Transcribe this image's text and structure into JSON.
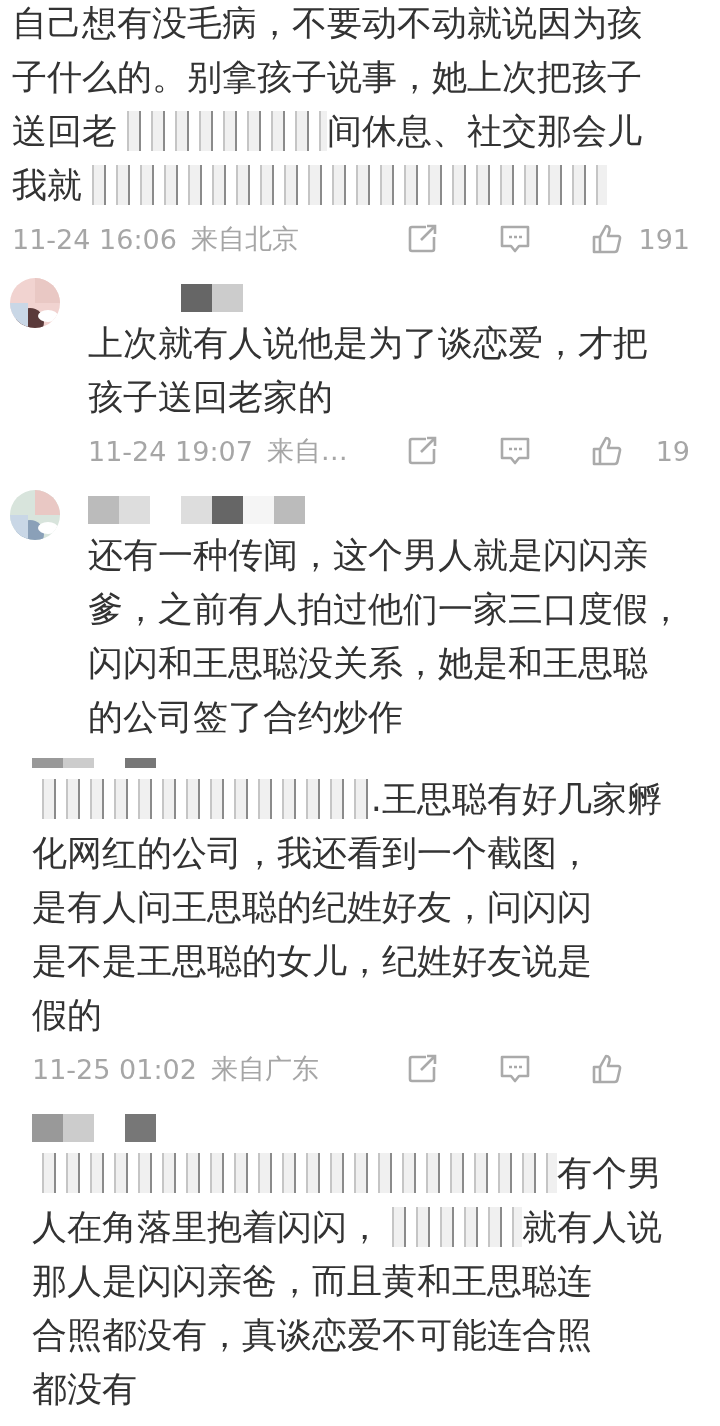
{
  "comments": [
    {
      "kind": "continuation",
      "lines": [
        [
          {
            "kind": "text",
            "text": "自己想有没毛病，不要动不动就说因为孩"
          }
        ],
        [
          {
            "kind": "text",
            "text": "子什么的。别拿孩子说事，她上次把孩子"
          }
        ],
        [
          {
            "kind": "text",
            "text": "送回老"
          },
          {
            "kind": "redacted"
          },
          {
            "kind": "text",
            "text": "间休息、社交那会儿"
          }
        ],
        [
          {
            "kind": "text",
            "text": "我就"
          },
          {
            "kind": "redacted"
          }
        ]
      ],
      "footer": {
        "date": "11-24 16:06",
        "location": "来自北京",
        "likes": "191"
      }
    },
    {
      "kind": "indented",
      "lines": [
        [
          {
            "kind": "text",
            "text": "上次就有人说他是为了谈恋爱，才把"
          }
        ],
        [
          {
            "kind": "text",
            "text": "孩子送回老家的"
          }
        ]
      ],
      "footer": {
        "date": "11-24 19:07",
        "location": "来自…",
        "likes": "19"
      }
    },
    {
      "kind": "indented",
      "lines": [
        [
          {
            "kind": "text",
            "text": "还有一种传闻，这个男人就是闪闪亲"
          }
        ],
        [
          {
            "kind": "text",
            "text": "爹，之前有人拍过他们一家三口度假，"
          }
        ],
        [
          {
            "kind": "text",
            "text": "闪闪和王思聪没关系，她是和王思聪"
          }
        ],
        [
          {
            "kind": "text",
            "text": "的公司签了合约炒作"
          }
        ]
      ]
    },
    {
      "kind": "flush",
      "lines": [
        [
          {
            "kind": "redacted"
          },
          {
            "kind": "text",
            "text": ".王思聪有好几家孵"
          }
        ],
        [
          {
            "kind": "text",
            "text": "化网红的公司，我还看到一个截图，"
          }
        ],
        [
          {
            "kind": "text",
            "text": "是有人问王思聪的纪姓好友，问闪闪"
          }
        ],
        [
          {
            "kind": "text",
            "text": "是不是王思聪的女儿，纪姓好友说是"
          }
        ],
        [
          {
            "kind": "text",
            "text": "假的"
          }
        ]
      ],
      "footer": {
        "date": "11-25 01:02",
        "location": "来自广东"
      }
    },
    {
      "kind": "flush",
      "lines": [
        [
          {
            "kind": "redacted"
          },
          {
            "kind": "text",
            "text": "有个男"
          }
        ],
        [
          {
            "kind": "text",
            "text": "人在角落里抱着闪闪，"
          },
          {
            "kind": "redacted"
          },
          {
            "kind": "text",
            "text": "就有人说"
          }
        ],
        [
          {
            "kind": "text",
            "text": "那人是闪闪亲爸，而且黄和王思聪连"
          }
        ],
        [
          {
            "kind": "text",
            "text": "合照都没有，真谈恋爱不可能连合照"
          }
        ],
        [
          {
            "kind": "text",
            "text": "都没有"
          }
        ]
      ]
    }
  ]
}
